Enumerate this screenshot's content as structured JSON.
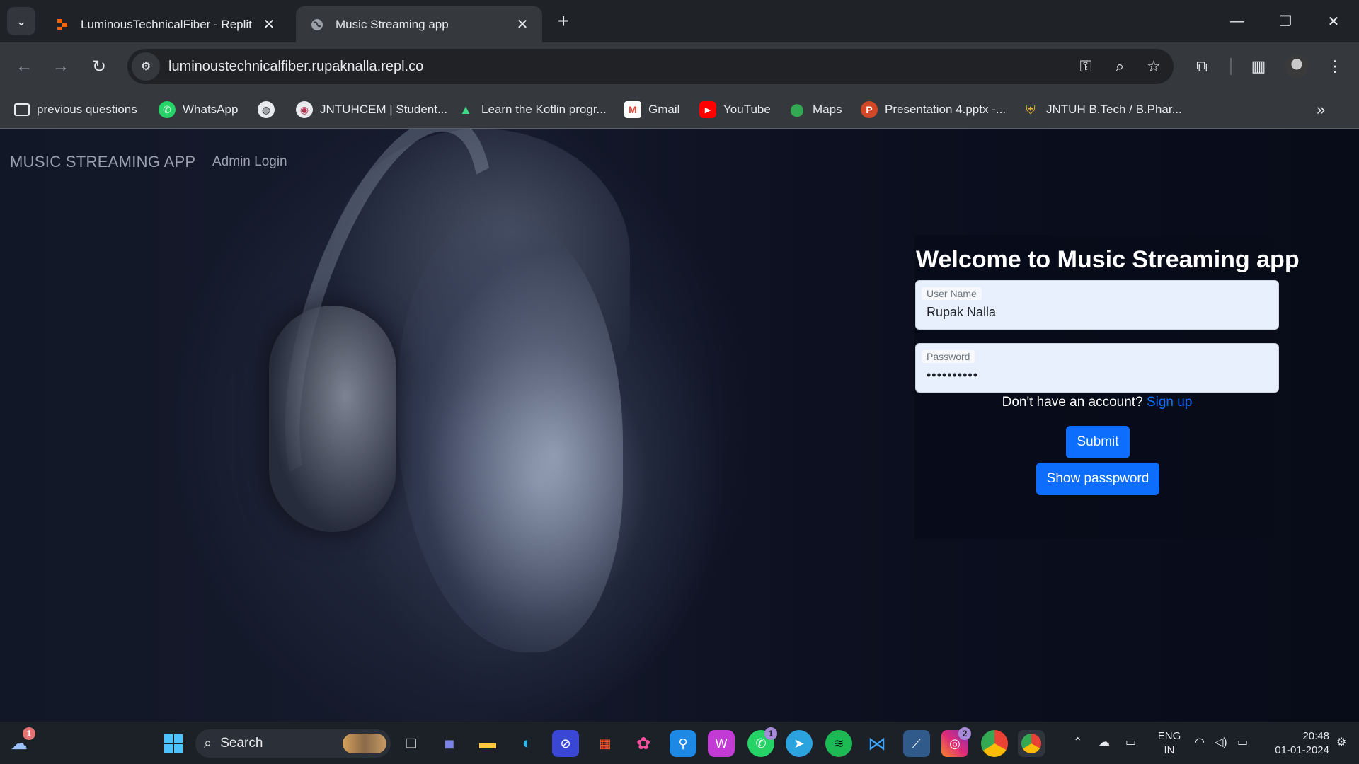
{
  "browser": {
    "tabs": [
      {
        "title": "LuminousTechnicalFiber - Replit",
        "active": false
      },
      {
        "title": "Music Streaming app",
        "active": true
      }
    ],
    "url": "luminoustechnicalfiber.rupaknalla.repl.co",
    "bookmarks": [
      {
        "label": "previous questions",
        "icon": "folder-icon"
      },
      {
        "label": "WhatsApp",
        "icon": "whatsapp-icon"
      },
      {
        "label": "",
        "icon": "globe-icon"
      },
      {
        "label": "JNTUHCEM | Student...",
        "icon": "jntuh-icon"
      },
      {
        "label": "Learn the Kotlin progr...",
        "icon": "android-icon"
      },
      {
        "label": "Gmail",
        "icon": "gmail-icon"
      },
      {
        "label": "YouTube",
        "icon": "youtube-icon"
      },
      {
        "label": "Maps",
        "icon": "maps-icon"
      },
      {
        "label": "Presentation 4.pptx -...",
        "icon": "powerpoint-icon"
      },
      {
        "label": "JNTUH B.Tech / B.Phar...",
        "icon": "jntuh-shield-icon"
      }
    ]
  },
  "app": {
    "brand": "MUSIC STREAMING APP",
    "nav_link": "Admin Login",
    "login": {
      "title": "Welcome to Music Streaming app",
      "username_label": "User Name",
      "username_value": "Rupak Nalla",
      "password_label": "Password",
      "password_value": "••••••••••",
      "signup_prompt": "Don't have an account?",
      "signup_link": "Sign up",
      "submit_label": "Submit",
      "show_password_label": "Show passpword"
    }
  },
  "taskbar": {
    "search_label": "Search",
    "weather_badge": "1",
    "whatsapp_badge": "1",
    "instagram_badge": "2",
    "language_line1": "ENG",
    "language_line2": "IN",
    "time": "20:48",
    "date": "01-01-2024"
  },
  "colors": {
    "accent": "#0d6efd",
    "chrome_dark": "#1f2226",
    "chrome_toolbar": "#35393e",
    "page_bg": "#0b0f1c"
  }
}
